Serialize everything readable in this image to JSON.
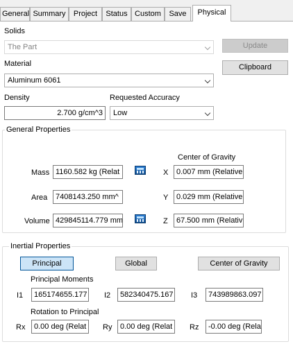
{
  "tabs": [
    {
      "label": "General"
    },
    {
      "label": "Summary"
    },
    {
      "label": "Project"
    },
    {
      "label": "Status"
    },
    {
      "label": "Custom"
    },
    {
      "label": "Save"
    },
    {
      "label": "Physical",
      "active": true
    }
  ],
  "solids": {
    "label": "Solids",
    "value": "The Part",
    "update_label": "Update"
  },
  "material": {
    "label": "Material",
    "value": "Aluminum 6061",
    "clipboard_label": "Clipboard"
  },
  "density": {
    "label": "Density",
    "value": "2.700 g/cm^3"
  },
  "accuracy": {
    "label": "Requested Accuracy",
    "value": "Low"
  },
  "general_properties": {
    "title": "General Properties",
    "mass_label": "Mass",
    "mass_value": "1160.582 kg (Relat",
    "area_label": "Area",
    "area_value": "7408143.250 mm^",
    "volume_label": "Volume",
    "volume_value": "429845114.779 mm",
    "cog_title": "Center of Gravity",
    "x_label": "X",
    "x_value": "0.007 mm (Relative",
    "y_label": "Y",
    "y_value": "0.029 mm (Relative",
    "z_label": "Z",
    "z_value": "67.500 mm (Relativ"
  },
  "inertial_properties": {
    "title": "Inertial Properties",
    "principal_label": "Principal",
    "global_label": "Global",
    "cog_label": "Center of Gravity",
    "moments_title": "Principal Moments",
    "i1_label": "I1",
    "i1_value": "165174655.177",
    "i2_label": "I2",
    "i2_value": "582340475.167",
    "i3_label": "I3",
    "i3_value": "743989863.097",
    "rotation_title": "Rotation to Principal",
    "rx_label": "Rx",
    "rx_value": "0.00 deg (Relat",
    "ry_label": "Ry",
    "ry_value": "0.00 deg (Relat",
    "rz_label": "Rz",
    "rz_value": "-0.00 deg (Rela"
  },
  "icons": {
    "calculator": "calculator-icon",
    "dropdown": "chevron-down-icon"
  },
  "colors": {
    "pressed_button": "#cce4f7",
    "pressed_border": "#005499",
    "icon_blue": "#1f6fc5"
  }
}
